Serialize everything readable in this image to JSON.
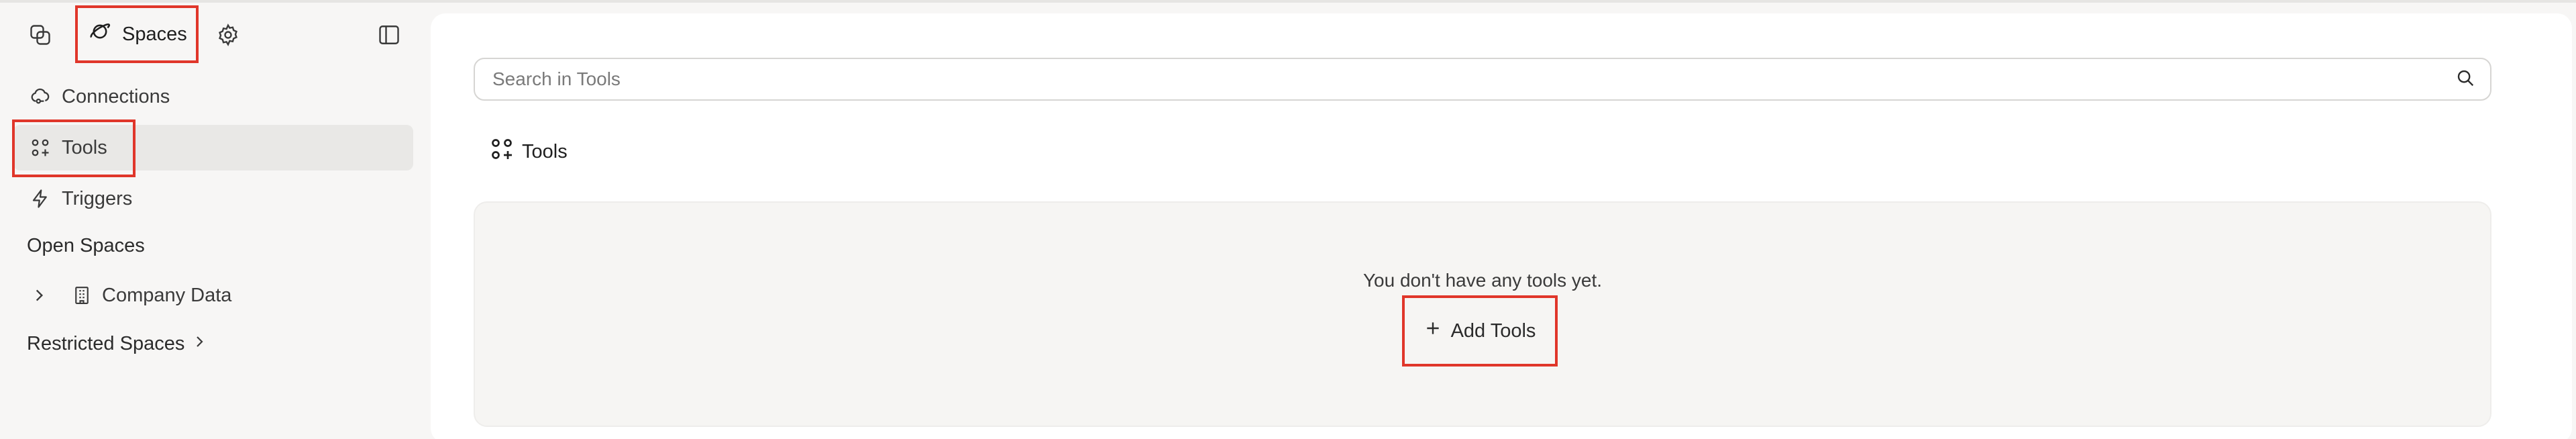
{
  "topbar": {
    "spaces_label": "Spaces"
  },
  "sidebar": {
    "items": [
      {
        "label": "Connections",
        "icon": "cloud-link-icon"
      },
      {
        "label": "Tools",
        "icon": "tools-grid-icon"
      },
      {
        "label": "Triggers",
        "icon": "lightning-icon"
      }
    ],
    "open_spaces_title": "Open Spaces",
    "open_spaces": [
      {
        "label": "Company Data",
        "icon": "building-icon"
      }
    ],
    "restricted_spaces_title": "Restricted Spaces"
  },
  "main": {
    "search_placeholder": "Search in Tools",
    "section_title": "Tools",
    "empty_message": "You don't have any tools yet.",
    "add_button_label": "Add Tools"
  },
  "colors": {
    "highlight": "#e0362a",
    "active_bg": "#e9e8e6",
    "page_bg": "#f7f6f5"
  }
}
